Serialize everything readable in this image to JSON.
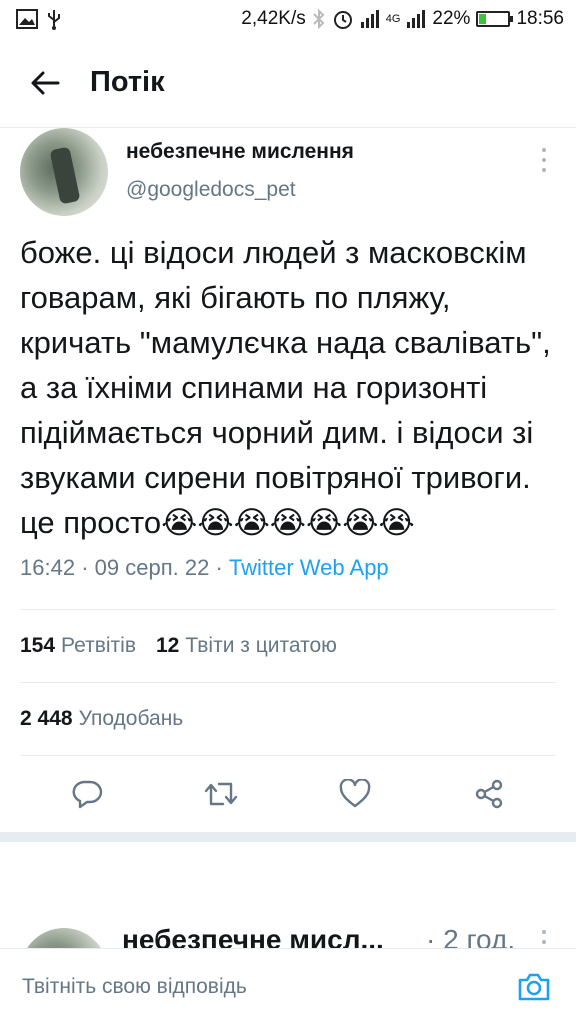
{
  "status_bar": {
    "net_speed": "2,42K/s",
    "network_label": "4G",
    "battery_percent": "22%",
    "time": "18:56"
  },
  "header": {
    "title": "Потік"
  },
  "tweet": {
    "display_name": "небезпечне мислення",
    "handle": "@googledocs_pet",
    "text": "боже. ці відоси людей з масковскім говарам, які бігають по пляжу, кричать \"мамулєчка нада свалівать\", а за їхніми спинами на горизонті підіймається чорний дим. і відоси зі звуками сирени повітряної тривоги. це просто😭😭😭😭😭😭😭",
    "time": "16:42",
    "date": "09 серп. 22",
    "separator": "·",
    "source": "Twitter Web App",
    "retweets_count": "154",
    "retweets_label": "Ретвітів",
    "quotes_count": "12",
    "quotes_label": "Твіти з цитатою",
    "likes_count": "2 448",
    "likes_label": "Уподобань"
  },
  "reply_preview": {
    "display_name": "небезпечне мисл...",
    "time": "· 2 год."
  },
  "compose": {
    "placeholder": "Твітніть свою відповідь"
  },
  "colors": {
    "accent": "#1da1f2",
    "secondary_text": "#657786",
    "divider": "#e6ecf0",
    "battery": "#39c43b"
  }
}
